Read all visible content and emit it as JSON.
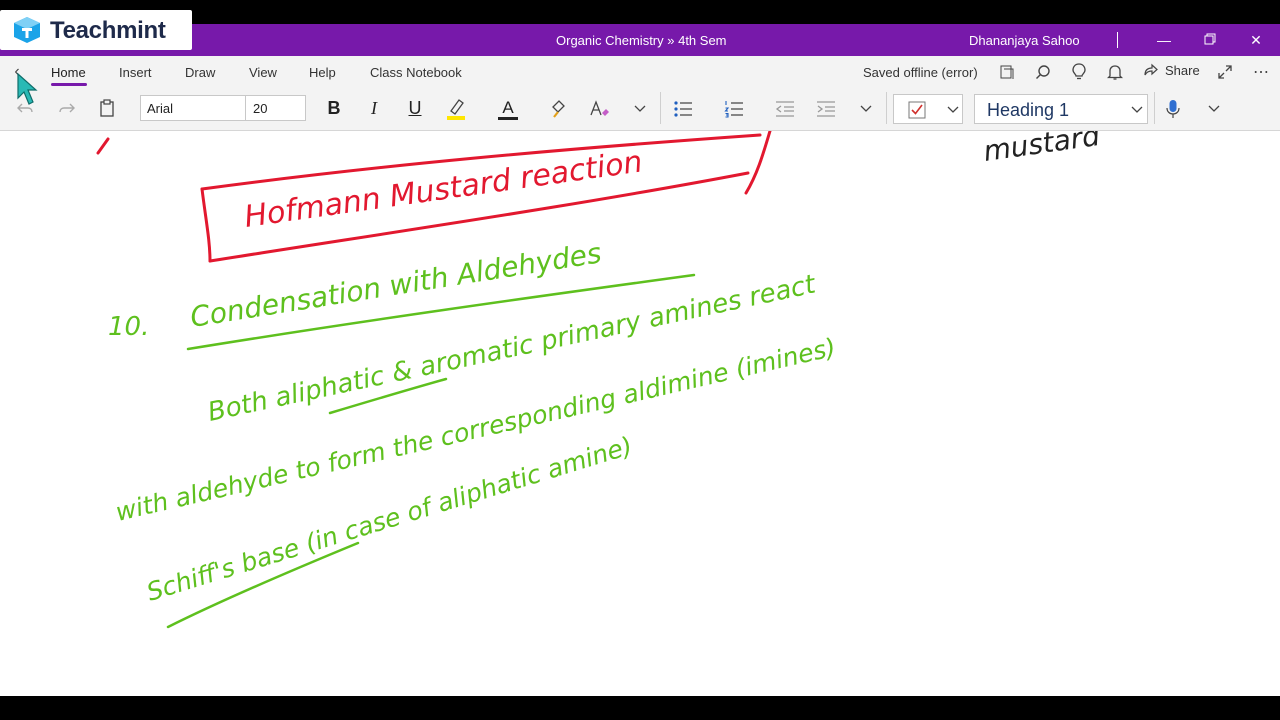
{
  "brand": {
    "name": "Teachmint"
  },
  "window": {
    "title": "Organic Chemistry » 4th Sem",
    "user": "Dhananjaya Sahoo"
  },
  "tabs": [
    {
      "label": "Home",
      "active": true
    },
    {
      "label": "Insert"
    },
    {
      "label": "Draw"
    },
    {
      "label": "View"
    },
    {
      "label": "Help"
    },
    {
      "label": "Class Notebook"
    }
  ],
  "status": {
    "saved": "Saved offline (error)"
  },
  "toolbar": {
    "share_label": "Share",
    "font_name": "Arial",
    "font_size": "20",
    "bold": "B",
    "italic": "I",
    "underline": "U",
    "font_color_glyph": "A",
    "style": "Heading 1"
  },
  "colors": {
    "title_bar": "#7719aa",
    "ink_red": "#e2182f",
    "ink_green": "#5ec01e",
    "ink_black": "#222222",
    "highlight": "#ffe600"
  },
  "notes": {
    "boxed_heading": "Hofmann Mustard reaction",
    "corner_fragment": "mustard",
    "item_number": "10.",
    "section_title": "Condensation with Aldehydes",
    "line1": "Both aliphatic & aromatic primary amines react",
    "line2": "with aldehyde to form the corresponding aldimine (imines)",
    "line3": "Schiff's base (in case of aliphatic amine)"
  }
}
